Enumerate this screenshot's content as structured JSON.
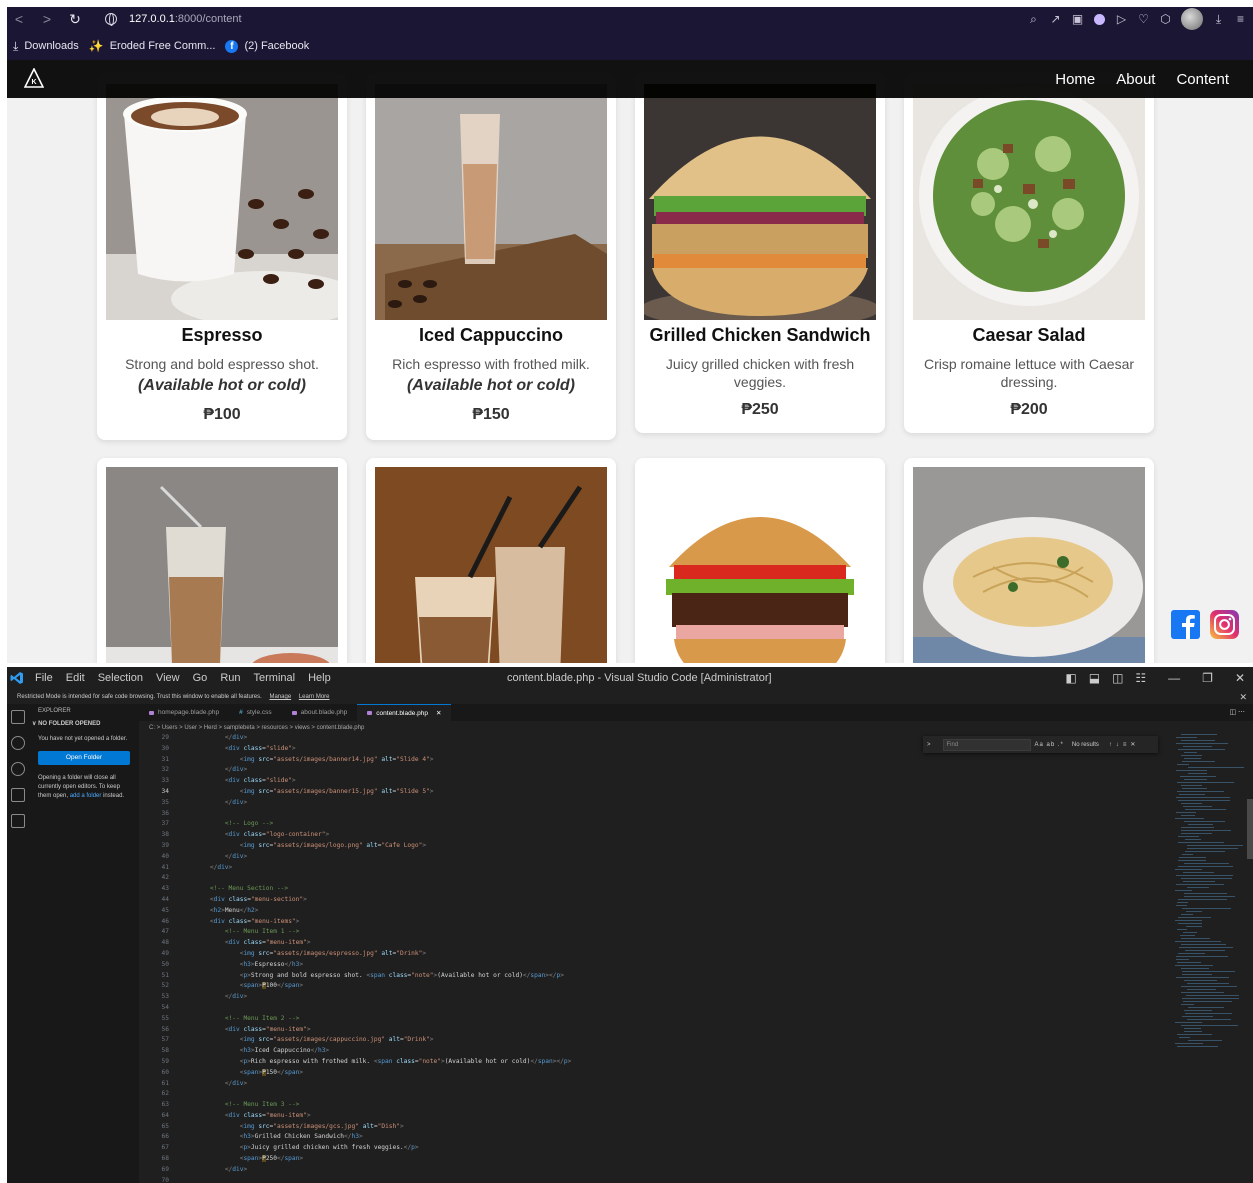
{
  "browser": {
    "url_host": "127.0.0.1",
    "url_path": ":8000/content",
    "bookmarks": [
      {
        "label": "Downloads"
      },
      {
        "label": "Eroded Free Comm..."
      },
      {
        "label": "(2) Facebook"
      }
    ]
  },
  "site": {
    "nav": [
      "Home",
      "About",
      "Content"
    ],
    "currency_symbol": "₱",
    "menu": [
      {
        "title": "Espresso",
        "desc": "Strong and bold espresso shot.",
        "note": "(Available hot or cold)",
        "price": "₱100"
      },
      {
        "title": "Iced Cappuccino",
        "desc": "Rich espresso with frothed milk.",
        "note": "(Available hot or cold)",
        "price": "₱150"
      },
      {
        "title": "Grilled Chicken Sandwich",
        "desc": "Juicy grilled chicken with fresh veggies.",
        "note": "",
        "price": "₱250"
      },
      {
        "title": "Caesar Salad",
        "desc": "Crisp romaine lettuce with Caesar dressing.",
        "note": "",
        "price": "₱200"
      }
    ],
    "social": [
      "facebook-icon",
      "instagram-icon"
    ]
  },
  "vscode": {
    "menu": [
      "File",
      "Edit",
      "Selection",
      "View",
      "Go",
      "Run",
      "Terminal",
      "Help"
    ],
    "window_title": "content.blade.php - Visual Studio Code [Administrator]",
    "banner": {
      "text": "Restricted Mode is intended for safe code browsing. Trust this window to enable all features.",
      "manage": "Manage",
      "learn_more": "Learn More"
    },
    "explorer": {
      "header": "EXPLORER",
      "section": "NO FOLDER OPENED",
      "message": "You have not yet opened a folder.",
      "open_folder": "Open Folder",
      "close_note_1": "Opening a folder will close all currently open editors. To keep them open,",
      "close_note_link": "add a folder",
      "close_note_2": "instead."
    },
    "tabs": [
      {
        "label": "homepage.blade.php",
        "active": false
      },
      {
        "label": "style.css",
        "active": false
      },
      {
        "label": "about.blade.php",
        "active": false
      },
      {
        "label": "content.blade.php",
        "active": true
      }
    ],
    "breadcrumb": "C: > Users > User > Herd > samplebeta > resources > views > content.blade.php",
    "find": {
      "placeholder": "Find",
      "options": "Aa ab .*",
      "result": "No results"
    },
    "code": [
      {
        "n": "29",
        "html": "        <span class='t-br'>&lt;/</span><span class='t-tag'>div</span><span class='t-br'>&gt;</span>"
      },
      {
        "n": "30",
        "html": "        <span class='t-br'>&lt;</span><span class='t-tag'>div</span> <span class='t-attr'>class</span>=<span class='t-str'>\"slide\"</span><span class='t-br'>&gt;</span>"
      },
      {
        "n": "31",
        "html": "            <span class='t-br'>&lt;</span><span class='t-tag'>img</span> <span class='t-attr'>src</span>=<span class='t-str'>\"assets/images/banner14.jpg\"</span> <span class='t-attr'>alt</span>=<span class='t-str'>\"Slide 4\"</span><span class='t-br'>&gt;</span>"
      },
      {
        "n": "32",
        "html": "        <span class='t-br'>&lt;/</span><span class='t-tag'>div</span><span class='t-br'>&gt;</span>"
      },
      {
        "n": "33",
        "html": "        <span class='t-br'>&lt;</span><span class='t-tag'>div</span> <span class='t-attr'>class</span>=<span class='t-str'>\"slide\"</span><span class='t-br'>&gt;</span>"
      },
      {
        "n": "34",
        "html": "            <span class='t-br'>&lt;</span><span class='t-tag'>img</span> <span class='t-attr'>src</span>=<span class='t-str'>\"assets/images/banner15.jpg\"</span> <span class='t-attr'>alt</span>=<span class='t-str'>\"Slide 5\"</span><span class='t-br'>&gt;</span>",
        "cur": true
      },
      {
        "n": "35",
        "html": "        <span class='t-br'>&lt;/</span><span class='t-tag'>div</span><span class='t-br'>&gt;</span>"
      },
      {
        "n": "36",
        "html": ""
      },
      {
        "n": "37",
        "html": "        <span class='t-com'>&lt;!-- Logo --&gt;</span>"
      },
      {
        "n": "38",
        "html": "        <span class='t-br'>&lt;</span><span class='t-tag'>div</span> <span class='t-attr'>class</span>=<span class='t-str'>\"logo-container\"</span><span class='t-br'>&gt;</span>"
      },
      {
        "n": "39",
        "html": "            <span class='t-br'>&lt;</span><span class='t-tag'>img</span> <span class='t-attr'>src</span>=<span class='t-str'>\"assets/images/logo.png\"</span> <span class='t-attr'>alt</span>=<span class='t-str'>\"Cafe Logo\"</span><span class='t-br'>&gt;</span>"
      },
      {
        "n": "40",
        "html": "        <span class='t-br'>&lt;/</span><span class='t-tag'>div</span><span class='t-br'>&gt;</span>"
      },
      {
        "n": "41",
        "html": "    <span class='t-br'>&lt;/</span><span class='t-tag'>div</span><span class='t-br'>&gt;</span>"
      },
      {
        "n": "42",
        "html": ""
      },
      {
        "n": "43",
        "html": "    <span class='t-com'>&lt;!-- Menu Section --&gt;</span>"
      },
      {
        "n": "44",
        "html": "    <span class='t-br'>&lt;</span><span class='t-tag'>div</span> <span class='t-attr'>class</span>=<span class='t-str'>\"menu-section\"</span><span class='t-br'>&gt;</span>"
      },
      {
        "n": "45",
        "html": "    <span class='t-br'>&lt;</span><span class='t-tag'>h2</span><span class='t-br'>&gt;</span><span class='t-txt'>Menu</span><span class='t-br'>&lt;/</span><span class='t-tag'>h2</span><span class='t-br'>&gt;</span>"
      },
      {
        "n": "46",
        "html": "    <span class='t-br'>&lt;</span><span class='t-tag'>div</span> <span class='t-attr'>class</span>=<span class='t-str'>\"menu-items\"</span><span class='t-br'>&gt;</span>"
      },
      {
        "n": "47",
        "html": "        <span class='t-com'>&lt;!-- Menu Item 1 --&gt;</span>"
      },
      {
        "n": "48",
        "html": "        <span class='t-br'>&lt;</span><span class='t-tag'>div</span> <span class='t-attr'>class</span>=<span class='t-str'>\"menu-item\"</span><span class='t-br'>&gt;</span>"
      },
      {
        "n": "49",
        "html": "            <span class='t-br'>&lt;</span><span class='t-tag'>img</span> <span class='t-attr'>src</span>=<span class='t-str'>\"assets/images/espresso.jpg\"</span> <span class='t-attr'>alt</span>=<span class='t-str'>\"Drink\"</span><span class='t-br'>&gt;</span>"
      },
      {
        "n": "50",
        "html": "            <span class='t-br'>&lt;</span><span class='t-tag'>h3</span><span class='t-br'>&gt;</span><span class='t-txt'>Espresso</span><span class='t-br'>&lt;/</span><span class='t-tag'>h3</span><span class='t-br'>&gt;</span>"
      },
      {
        "n": "51",
        "html": "            <span class='t-br'>&lt;</span><span class='t-tag'>p</span><span class='t-br'>&gt;</span><span class='t-txt'>Strong and bold espresso shot. </span><span class='t-br'>&lt;</span><span class='t-tag'>span</span> <span class='t-attr'>class</span>=<span class='t-str'>\"note\"</span><span class='t-br'>&gt;</span><span class='t-txt'>(Available hot or cold)</span><span class='t-br'>&lt;/</span><span class='t-tag'>span</span><span class='t-br'>&gt;&lt;/</span><span class='t-tag'>p</span><span class='t-br'>&gt;</span>"
      },
      {
        "n": "52",
        "html": "            <span class='t-br'>&lt;</span><span class='t-tag'>span</span><span class='t-br'>&gt;</span><span class='t-txt hl-peso'>₱</span><span class='t-txt'>100</span><span class='t-br'>&lt;/</span><span class='t-tag'>span</span><span class='t-br'>&gt;</span>"
      },
      {
        "n": "53",
        "html": "        <span class='t-br'>&lt;/</span><span class='t-tag'>div</span><span class='t-br'>&gt;</span>"
      },
      {
        "n": "54",
        "html": ""
      },
      {
        "n": "55",
        "html": "        <span class='t-com'>&lt;!-- Menu Item 2 --&gt;</span>"
      },
      {
        "n": "56",
        "html": "        <span class='t-br'>&lt;</span><span class='t-tag'>div</span> <span class='t-attr'>class</span>=<span class='t-str'>\"menu-item\"</span><span class='t-br'>&gt;</span>"
      },
      {
        "n": "57",
        "html": "            <span class='t-br'>&lt;</span><span class='t-tag'>img</span> <span class='t-attr'>src</span>=<span class='t-str'>\"assets/images/cappuccino.jpg\"</span> <span class='t-attr'>alt</span>=<span class='t-str'>\"Drink\"</span><span class='t-br'>&gt;</span>"
      },
      {
        "n": "58",
        "html": "            <span class='t-br'>&lt;</span><span class='t-tag'>h3</span><span class='t-br'>&gt;</span><span class='t-txt'>Iced Cappuccino</span><span class='t-br'>&lt;/</span><span class='t-tag'>h3</span><span class='t-br'>&gt;</span>"
      },
      {
        "n": "59",
        "html": "            <span class='t-br'>&lt;</span><span class='t-tag'>p</span><span class='t-br'>&gt;</span><span class='t-txt'>Rich espresso with frothed milk. </span><span class='t-br'>&lt;</span><span class='t-tag'>span</span> <span class='t-attr'>class</span>=<span class='t-str'>\"note\"</span><span class='t-br'>&gt;</span><span class='t-txt'>(Available hot or cold)</span><span class='t-br'>&lt;/</span><span class='t-tag'>span</span><span class='t-br'>&gt;&lt;/</span><span class='t-tag'>p</span><span class='t-br'>&gt;</span>"
      },
      {
        "n": "60",
        "html": "            <span class='t-br'>&lt;</span><span class='t-tag'>span</span><span class='t-br'>&gt;</span><span class='t-txt hl-peso'>₱</span><span class='t-txt'>150</span><span class='t-br'>&lt;/</span><span class='t-tag'>span</span><span class='t-br'>&gt;</span>"
      },
      {
        "n": "61",
        "html": "        <span class='t-br'>&lt;/</span><span class='t-tag'>div</span><span class='t-br'>&gt;</span>"
      },
      {
        "n": "62",
        "html": ""
      },
      {
        "n": "63",
        "html": "        <span class='t-com'>&lt;!-- Menu Item 3 --&gt;</span>"
      },
      {
        "n": "64",
        "html": "        <span class='t-br'>&lt;</span><span class='t-tag'>div</span> <span class='t-attr'>class</span>=<span class='t-str'>\"menu-item\"</span><span class='t-br'>&gt;</span>"
      },
      {
        "n": "65",
        "html": "            <span class='t-br'>&lt;</span><span class='t-tag'>img</span> <span class='t-attr'>src</span>=<span class='t-str'>\"assets/images/gcs.jpg\"</span> <span class='t-attr'>alt</span>=<span class='t-str'>\"Dish\"</span><span class='t-br'>&gt;</span>"
      },
      {
        "n": "66",
        "html": "            <span class='t-br'>&lt;</span><span class='t-tag'>h3</span><span class='t-br'>&gt;</span><span class='t-txt'>Grilled Chicken Sandwich</span><span class='t-br'>&lt;/</span><span class='t-tag'>h3</span><span class='t-br'>&gt;</span>"
      },
      {
        "n": "67",
        "html": "            <span class='t-br'>&lt;</span><span class='t-tag'>p</span><span class='t-br'>&gt;</span><span class='t-txt'>Juicy grilled chicken with fresh veggies.</span><span class='t-br'>&lt;/</span><span class='t-tag'>p</span><span class='t-br'>&gt;</span>"
      },
      {
        "n": "68",
        "html": "            <span class='t-br'>&lt;</span><span class='t-tag'>span</span><span class='t-br'>&gt;</span><span class='t-txt hl-peso'>₱</span><span class='t-txt'>250</span><span class='t-br'>&lt;/</span><span class='t-tag'>span</span><span class='t-br'>&gt;</span>"
      },
      {
        "n": "69",
        "html": "        <span class='t-br'>&lt;/</span><span class='t-tag'>div</span><span class='t-br'>&gt;</span>"
      },
      {
        "n": "70",
        "html": ""
      }
    ]
  }
}
